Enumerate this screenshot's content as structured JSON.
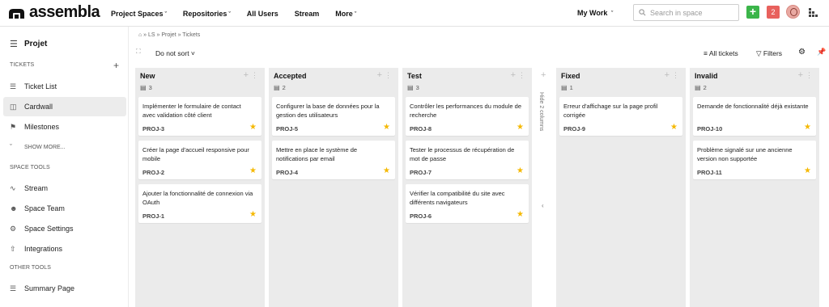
{
  "header": {
    "logo_text": "assembla",
    "nav": [
      {
        "label": "Project Spaces",
        "caret": "ˇ"
      },
      {
        "label": "Repositories",
        "caret": "ˇ"
      },
      {
        "label": "All Users",
        "caret": ""
      },
      {
        "label": "Stream",
        "caret": ""
      },
      {
        "label": "More",
        "caret": "ˇ"
      }
    ],
    "my_work": "My Work",
    "my_work_caret": "ˇ",
    "search_placeholder": "Search in space",
    "add_label": "+",
    "notification_count": "2",
    "accent_color": "#3bb54a",
    "notif_color": "#e8615d"
  },
  "sidebar": {
    "project": "Projet",
    "tickets_section": "TICKETS",
    "tickets_plus": "+",
    "tickets_items": [
      {
        "icon": "ticket-list-icon",
        "glyph": "☰",
        "label": "Ticket List"
      },
      {
        "icon": "cardwall-icon",
        "glyph": "◫",
        "label": "Cardwall",
        "active": true
      },
      {
        "icon": "milestones-icon",
        "glyph": "⚑",
        "label": "Milestones"
      },
      {
        "icon": "chevron-down-icon",
        "glyph": "ˇ",
        "label": "SHOW MORE..."
      }
    ],
    "space_tools_section": "SPACE TOOLS",
    "space_tools": [
      {
        "icon": "stream-icon",
        "glyph": "∿",
        "label": "Stream"
      },
      {
        "icon": "team-icon",
        "glyph": "☻",
        "label": "Space Team"
      },
      {
        "icon": "gear-icon",
        "glyph": "⚙",
        "label": "Space Settings"
      },
      {
        "icon": "integrations-icon",
        "glyph": "⇧",
        "label": "Integrations"
      }
    ],
    "other_tools_section": "OTHER TOOLS",
    "other_tools": [
      {
        "icon": "summary-icon",
        "glyph": "☰",
        "label": "Summary Page"
      }
    ]
  },
  "toolbar": {
    "breadcrumb": "⌂ » LS » Projet » Tickets",
    "sort_label": "Do not sort ˅",
    "all_tickets": "≡ All tickets",
    "filters": "▽ Filters",
    "hide_columns": "Hide 2 columns"
  },
  "columns": [
    {
      "title": "New",
      "count": "3",
      "cards": [
        {
          "title": "Implémenter le formulaire de contact avec validation côté client",
          "id": "PROJ-3"
        },
        {
          "title": "Créer la page d'accueil responsive pour mobile",
          "id": "PROJ-2"
        },
        {
          "title": "Ajouter la fonctionnalité de connexion via OAuth",
          "id": "PROJ-1"
        }
      ]
    },
    {
      "title": "Accepted",
      "count": "2",
      "cards": [
        {
          "title": "Configurer la base de données pour la gestion des utilisateurs",
          "id": "PROJ-5"
        },
        {
          "title": "Mettre en place le système de notifications par email",
          "id": "PROJ-4"
        }
      ]
    },
    {
      "title": "Test",
      "count": "3",
      "cards": [
        {
          "title": "Contrôler les performances du module de recherche",
          "id": "PROJ-8"
        },
        {
          "title": "Tester le processus de récupération de mot de passe",
          "id": "PROJ-7"
        },
        {
          "title": "Vérifier la compatibilité du site avec différents navigateurs",
          "id": "PROJ-6"
        }
      ]
    },
    {
      "title": "Fixed",
      "count": "1",
      "cards": [
        {
          "title": "Erreur d'affichage sur la page profil corrigée",
          "id": "PROJ-9"
        }
      ]
    },
    {
      "title": "Invalid",
      "count": "2",
      "cards": [
        {
          "title": "Demande de fonctionnalité déjà existante",
          "id": "PROJ-10"
        },
        {
          "title": "Problème signalé sur une ancienne version non supportée",
          "id": "PROJ-11"
        }
      ]
    }
  ]
}
